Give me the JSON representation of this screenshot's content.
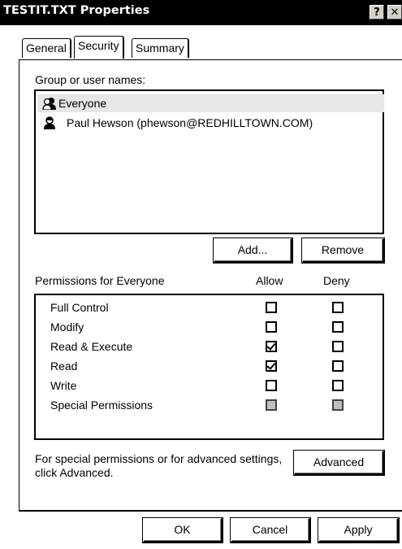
{
  "window": {
    "title": "TESTIT.TXT Properties",
    "help_button": "?",
    "close_button": "✕"
  },
  "tabs": [
    {
      "label": "General",
      "active": false
    },
    {
      "label": "Security",
      "active": true
    },
    {
      "label": "Summary",
      "active": false
    }
  ],
  "security": {
    "group_label": "Group or user names:",
    "users": [
      {
        "name": "Everyone",
        "icon": "group-icon",
        "selected": true
      },
      {
        "name": "Paul Hewson (phewson@REDHILLTOWN.COM)",
        "icon": "user-icon",
        "selected": false
      }
    ],
    "add_label": "Add...",
    "remove_label": "Remove",
    "permissions_label": "Permissions for Everyone",
    "allow_header": "Allow",
    "deny_header": "Deny",
    "permissions": [
      {
        "name": "Full Control",
        "allow": "unchecked",
        "deny": "unchecked"
      },
      {
        "name": "Modify",
        "allow": "unchecked",
        "deny": "unchecked"
      },
      {
        "name": "Read & Execute",
        "allow": "checked",
        "deny": "unchecked"
      },
      {
        "name": "Read",
        "allow": "checked",
        "deny": "unchecked"
      },
      {
        "name": "Write",
        "allow": "unchecked",
        "deny": "unchecked"
      },
      {
        "name": "Special Permissions",
        "allow": "disabled",
        "deny": "disabled"
      }
    ],
    "advanced_text_line1": "For special permissions or for advanced settings,",
    "advanced_text_line2": "click Advanced.",
    "advanced_label": "Advanced"
  },
  "footer": {
    "ok_label": "OK",
    "cancel_label": "Cancel",
    "apply_label": "Apply"
  }
}
